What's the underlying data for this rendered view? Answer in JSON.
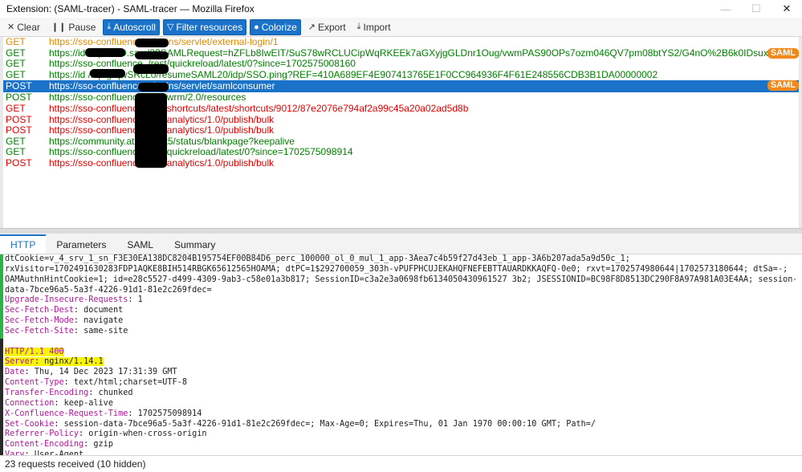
{
  "window": {
    "title": "Extension: (SAML-tracer) - SAML-tracer — Mozilla Firefox",
    "minimize": "—",
    "maximize": "☐",
    "close": "✕"
  },
  "toolbar": {
    "clear": "Clear",
    "pause": "Pause",
    "autoscroll": "Autoscroll",
    "filter": "Filter resources",
    "colorize": "Colorize",
    "export": "Export",
    "import": "Import"
  },
  "requests": [
    {
      "method": "GET",
      "url": "https://sso-confluence.                    plugins/servlet/external-login/1",
      "color": "#e08a00"
    },
    {
      "method": "GET",
      "url": "https://id                     /idp/SSO.saml2?SAMLRequest=hZFLb8IwEIT/SuS78wRCLUCipWqRKEEk7aGXyjgGLDnr1Oug/vwmPAS90OPs7ozm046QV7pm08btYS2/G4nO%2B6k0IDsuxqSxwAx",
      "color": "#008000",
      "badge": "SAML"
    },
    {
      "method": "GET",
      "url": "https://sso-confluence.                    /rest/quickreload/latest/0?since=1702575008160",
      "color": "#008000"
    },
    {
      "method": "GET",
      "url": "https://id                     /idp/grqwSRcLo/resumeSAML20/idp/SSO.ping?REF=410A689EF4E907413765E1F0CC964936F4F61E248556CDB3B1DA00000002",
      "color": "#008000"
    },
    {
      "method": "POST",
      "url": "https://sso-confluence.                    plugins/servlet/samlconsumer",
      "color": "#ffffff",
      "badge": "SAML",
      "selected": true
    },
    {
      "method": "POST",
      "url": "https://sso-confluence                     /rest/wrm/2.0/resources",
      "color": "#008000"
    },
    {
      "method": "GET",
      "url": "https://sso-confluence                     /rest/shortcuts/latest/shortcuts/9012/87e2076e794af2a99c45a20a02ad5d8b",
      "color": "#e60000"
    },
    {
      "method": "POST",
      "url": "https://sso-confluence                     /rest/analytics/1.0/publish/bulk",
      "color": "#e60000"
    },
    {
      "method": "POST",
      "url": "https://sso-confluence                     /rest/analytics/1.0/publish/bulk",
      "color": "#e60000"
    },
    {
      "method": "GET",
      "url": "https://community.atlass              m/t5/status/blankpage?keepalive",
      "color": "#008000"
    },
    {
      "method": "GET",
      "url": "https://sso-confluence                     /rest/quickreload/latest/0?since=1702575098914",
      "color": "#008000"
    },
    {
      "method": "POST",
      "url": "https://sso-confluence                     /rest/analytics/1.0/publish/bulk",
      "color": "#e60000"
    }
  ],
  "tabs": [
    "HTTP",
    "Parameters",
    "SAML",
    "Summary"
  ],
  "details": [
    {
      "text": "dtCookie=v_4_srv_1_sn_F3E30EA138DC8204B195754EF00B84D6_perc_100000_ol_0_mul_1_app-3Aea7c4b59f27d43eb_1_app-3A6b207ada5a9d50c_1;"
    },
    {
      "text": "rxVisitor=1702491630283FDP1AQKE8BIH514RBGK65612565HOAMA; dtPC=1$292700059_303h-vPUFPHCUJEKAHQFNEFEBTTAUARDKKAQFQ-0e0; rxvt=1702574980644|1702573180644; dtSa=-;"
    },
    {
      "text": "OAMAuthnHintCookie=1; id=e28c5527-d499-4309-9ab3-c58e01a3b817; SessionID=c3a2e3a0698fb6134050430961527 3b2; JSESSIONID=BC98F8D8513DC290F8A97A981A03E4AA; session-"
    },
    {
      "text": "data-7bce96a5-5a3f-4226-91d1-81e2c269fdec="
    },
    {
      "name": "Upgrade-Insecure-Requests",
      "value": " 1"
    },
    {
      "name": "Sec-Fetch-Dest",
      "value": " document"
    },
    {
      "name": "Sec-Fetch-Mode",
      "value": " navigate"
    },
    {
      "name": "Sec-Fetch-Site",
      "value": " same-site"
    },
    {
      "text": ""
    },
    {
      "text": "HTTP/1.1 400",
      "hl": true,
      "status": true
    },
    {
      "name": "Server",
      "value": " nginx/1.14.1",
      "hl": true
    },
    {
      "name": "Date",
      "value": " Thu, 14 Dec 2023 17:31:39 GMT"
    },
    {
      "name": "Content-Type",
      "value": " text/html;charset=UTF-8"
    },
    {
      "name": "Transfer-Encoding",
      "value": " chunked"
    },
    {
      "name": "Connection",
      "value": " keep-alive"
    },
    {
      "name": "X-Confluence-Request-Time",
      "value": " 1702575098914"
    },
    {
      "name": "Set-Cookie",
      "value": " session-data-7bce96a5-5a3f-4226-91d1-81e2c269fdec=; Max-Age=0; Expires=Thu, 01 Jan 1970 00:00:10 GMT; Path=/"
    },
    {
      "name": "Referrer-Policy",
      "value": " origin-when-cross-origin"
    },
    {
      "name": "Content-Encoding",
      "value": " gzip"
    },
    {
      "name": "Vary",
      "value": " User-Agent"
    }
  ],
  "status": "23 requests received (10 hidden)",
  "colors": {
    "accent": "#1a73c8",
    "saml_badge": "#f0891a",
    "header_name": "#b0179a",
    "highlight": "#f7f30a"
  }
}
